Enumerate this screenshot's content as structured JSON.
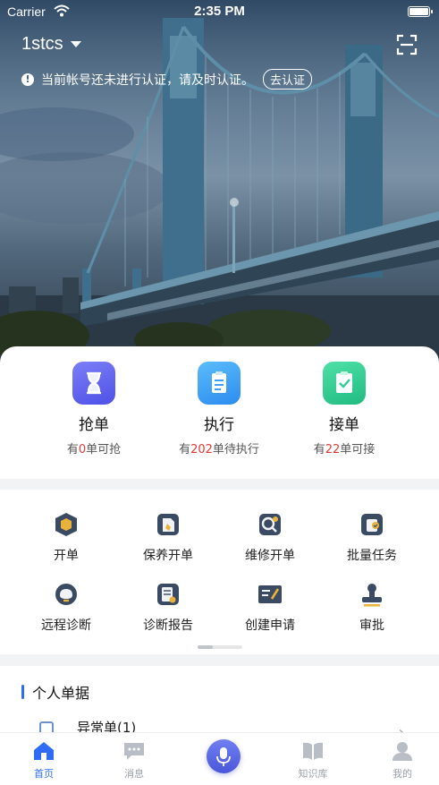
{
  "status_bar": {
    "carrier": "Carrier",
    "time": "2:35 PM"
  },
  "header": {
    "account": "1stcs",
    "notice": "当前帐号还未进行认证，请及时认证。",
    "verify_label": "去认证"
  },
  "quick_actions": [
    {
      "label": "抢单",
      "prefix": "有",
      "count": "0",
      "suffix": "单可抢",
      "icon": "hourglass-icon",
      "color": "#5b5ff0"
    },
    {
      "label": "执行",
      "prefix": "有",
      "count": "202",
      "suffix": "单待执行",
      "icon": "clipboard-icon",
      "color": "#3ea0f5"
    },
    {
      "label": "接单",
      "prefix": "有",
      "count": "22",
      "suffix": "单可接",
      "icon": "clipboard-check-icon",
      "color": "#2fcf94"
    }
  ],
  "functions": [
    {
      "label": "开单",
      "icon": "hexagon-icon"
    },
    {
      "label": "保养开单",
      "icon": "maintenance-doc-icon"
    },
    {
      "label": "维修开单",
      "icon": "repair-search-icon"
    },
    {
      "label": "批量任务",
      "icon": "batch-task-icon"
    },
    {
      "label": "远程诊断",
      "icon": "remote-diagnosis-icon"
    },
    {
      "label": "诊断报告",
      "icon": "report-icon"
    },
    {
      "label": "创建申请",
      "icon": "create-request-icon"
    },
    {
      "label": "审批",
      "icon": "stamp-icon"
    }
  ],
  "personal": {
    "title": "个人单据",
    "rows": [
      {
        "label": "异常单(1)"
      }
    ]
  },
  "tabbar": [
    {
      "label": "首页",
      "icon": "home-icon",
      "active": true
    },
    {
      "label": "消息",
      "icon": "message-icon"
    },
    {
      "label": "",
      "icon": "microphone-icon"
    },
    {
      "label": "知识库",
      "icon": "book-icon"
    },
    {
      "label": "我的",
      "icon": "profile-icon"
    }
  ],
  "colors": {
    "accent": "#2f6cf6",
    "count_red": "#e53935"
  }
}
